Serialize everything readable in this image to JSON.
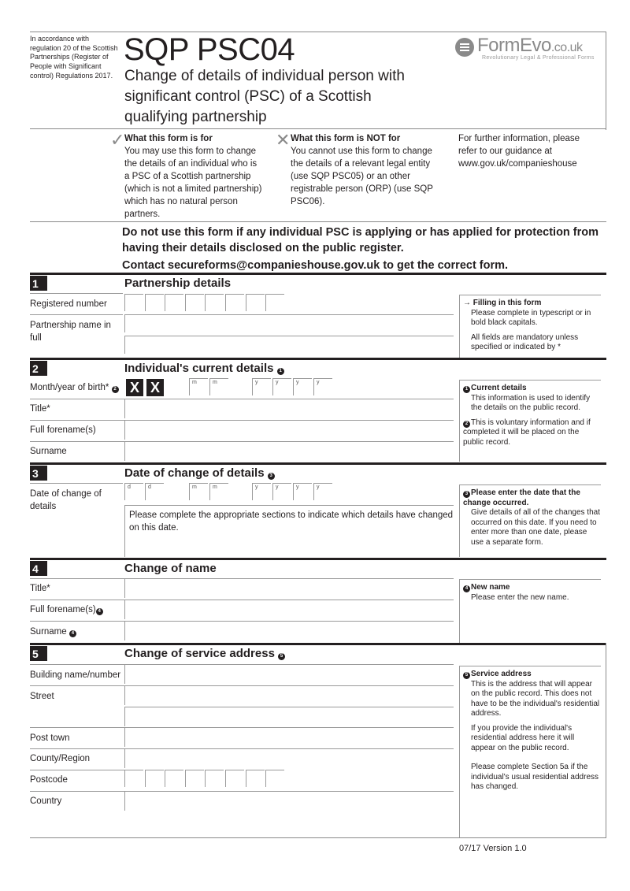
{
  "header": {
    "regulation_text": "In accordance with regulation 20 of the Scottish Partnerships (Register of People with Significant control) Regulations 2017.",
    "form_code": "SQP PSC04",
    "form_title": "Change of details of individual person with significant control (PSC) of a Scottish qualifying partnership",
    "logo": {
      "name": "FormEvo",
      "tld": ".co.uk",
      "tagline": "Revolutionary Legal & Professional Forms",
      "icon": "formevo-logo-icon"
    }
  },
  "intro": {
    "for": {
      "icon": "check-icon",
      "title": "What this form is for",
      "body": "You may use this form to change the details of an individual who is a PSC of a Scottish partnership (which is not a limited partnership) which has no natural person partners."
    },
    "not_for": {
      "icon": "cross-icon",
      "title": "What this form is NOT for",
      "body": "You cannot use this form to change the details of a relevant legal entity (use SQP PSC05) or an other registrable person (ORP) (use SQP PSC06)."
    },
    "further_info": "For further information, please refer to our guidance at www.gov.uk/companieshouse"
  },
  "warning": {
    "line1": "Do not use this form if any individual PSC is applying or has applied for protection from having their details disclosed on the public register.",
    "line2": "Contact secureforms@companieshouse.gov.uk to get the correct form."
  },
  "sections": {
    "s1": {
      "number": "1",
      "title": "Partnership details",
      "labels": {
        "registered_number": "Registered number",
        "partnership_name": "Partnership name in full"
      },
      "side": {
        "title": "Filling in this form",
        "body": "Please complete in typescript or in bold black capitals.",
        "body2": "All fields are mandatory unless specified or indicated by *"
      }
    },
    "s2": {
      "number": "2",
      "title": "Individual's current details",
      "title_note": "1",
      "labels": {
        "month_year": "Month/year of birth*",
        "month_year_note": "2",
        "title": "Title*",
        "forenames": "Full forename(s)",
        "surname": "Surname"
      },
      "blocked": [
        "X",
        "X"
      ],
      "month_placeholders": [
        "m",
        "m"
      ],
      "year_placeholders": [
        "y",
        "y",
        "y",
        "y"
      ],
      "side": {
        "note1_num": "1",
        "note1_title": "Current details",
        "note1_body": "This information is used to identify the details on the public record.",
        "note2_num": "2",
        "note2_body": "This is voluntary information and if completed it will be placed on the public record."
      }
    },
    "s3": {
      "number": "3",
      "title": "Date of change of details",
      "title_note": "3",
      "labels": {
        "date": "Date of change of details"
      },
      "day_placeholders": [
        "d",
        "d"
      ],
      "month_placeholders": [
        "m",
        "m"
      ],
      "year_placeholders": [
        "y",
        "y",
        "y",
        "y"
      ],
      "instruction": "Please complete the appropriate sections to indicate which details have changed on this date.",
      "side": {
        "num": "3",
        "title": "Please enter the date that the change occurred.",
        "body": "Give details of all of the changes that occurred on this date. If you need to enter more than one date, please use a separate form."
      }
    },
    "s4": {
      "number": "4",
      "title": "Change of name",
      "labels": {
        "title": "Title*",
        "forenames": "Full forename(s)",
        "surname": "Surname"
      },
      "label_note": "4",
      "side": {
        "num": "4",
        "title": "New name",
        "body": "Please enter the new name."
      }
    },
    "s5": {
      "number": "5",
      "title": "Change of service address",
      "title_note": "5",
      "labels": {
        "building": "Building name/number",
        "street": "Street",
        "post_town": "Post town",
        "county": "County/Region",
        "postcode": "Postcode",
        "country": "Country"
      },
      "side": {
        "num": "5",
        "title": "Service address",
        "body1": "This is the address that will appear on the public record. This does not have to be the individual's residential address.",
        "body2": "If you provide the individual's residential address here it will appear on the public record.",
        "body3": "Please complete Section 5a if the individual's usual residential address has changed."
      }
    }
  },
  "footer": {
    "version": "07/17 Version 1.0"
  }
}
